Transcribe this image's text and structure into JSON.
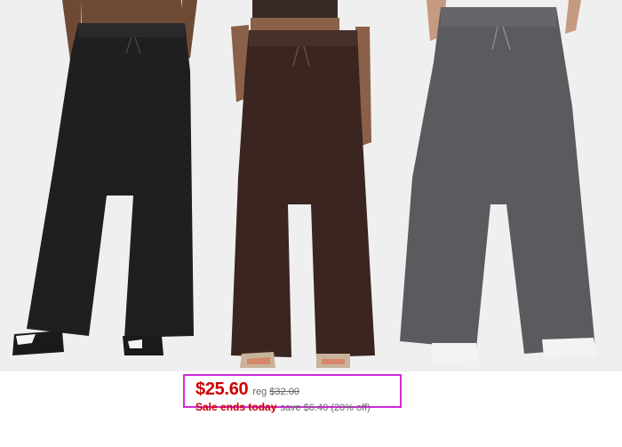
{
  "products": [
    {
      "color_name": "black",
      "pants_color": "#1f1f21",
      "skin_color": "#6e4a35"
    },
    {
      "color_name": "brown",
      "pants_color": "#3a2520",
      "skin_color": "#8a6048"
    },
    {
      "color_name": "gray",
      "pants_color": "#5b5b5f",
      "skin_color": "#c59a7f"
    }
  ],
  "pricing": {
    "sale_price": "$25.60",
    "reg_label": "reg",
    "reg_price": "$32.00",
    "sale_note": "Sale ends today",
    "savings": "save $6.40 (20% off)",
    "accent_color": "#cc0000",
    "highlight_border_color": "#d22bd8"
  }
}
